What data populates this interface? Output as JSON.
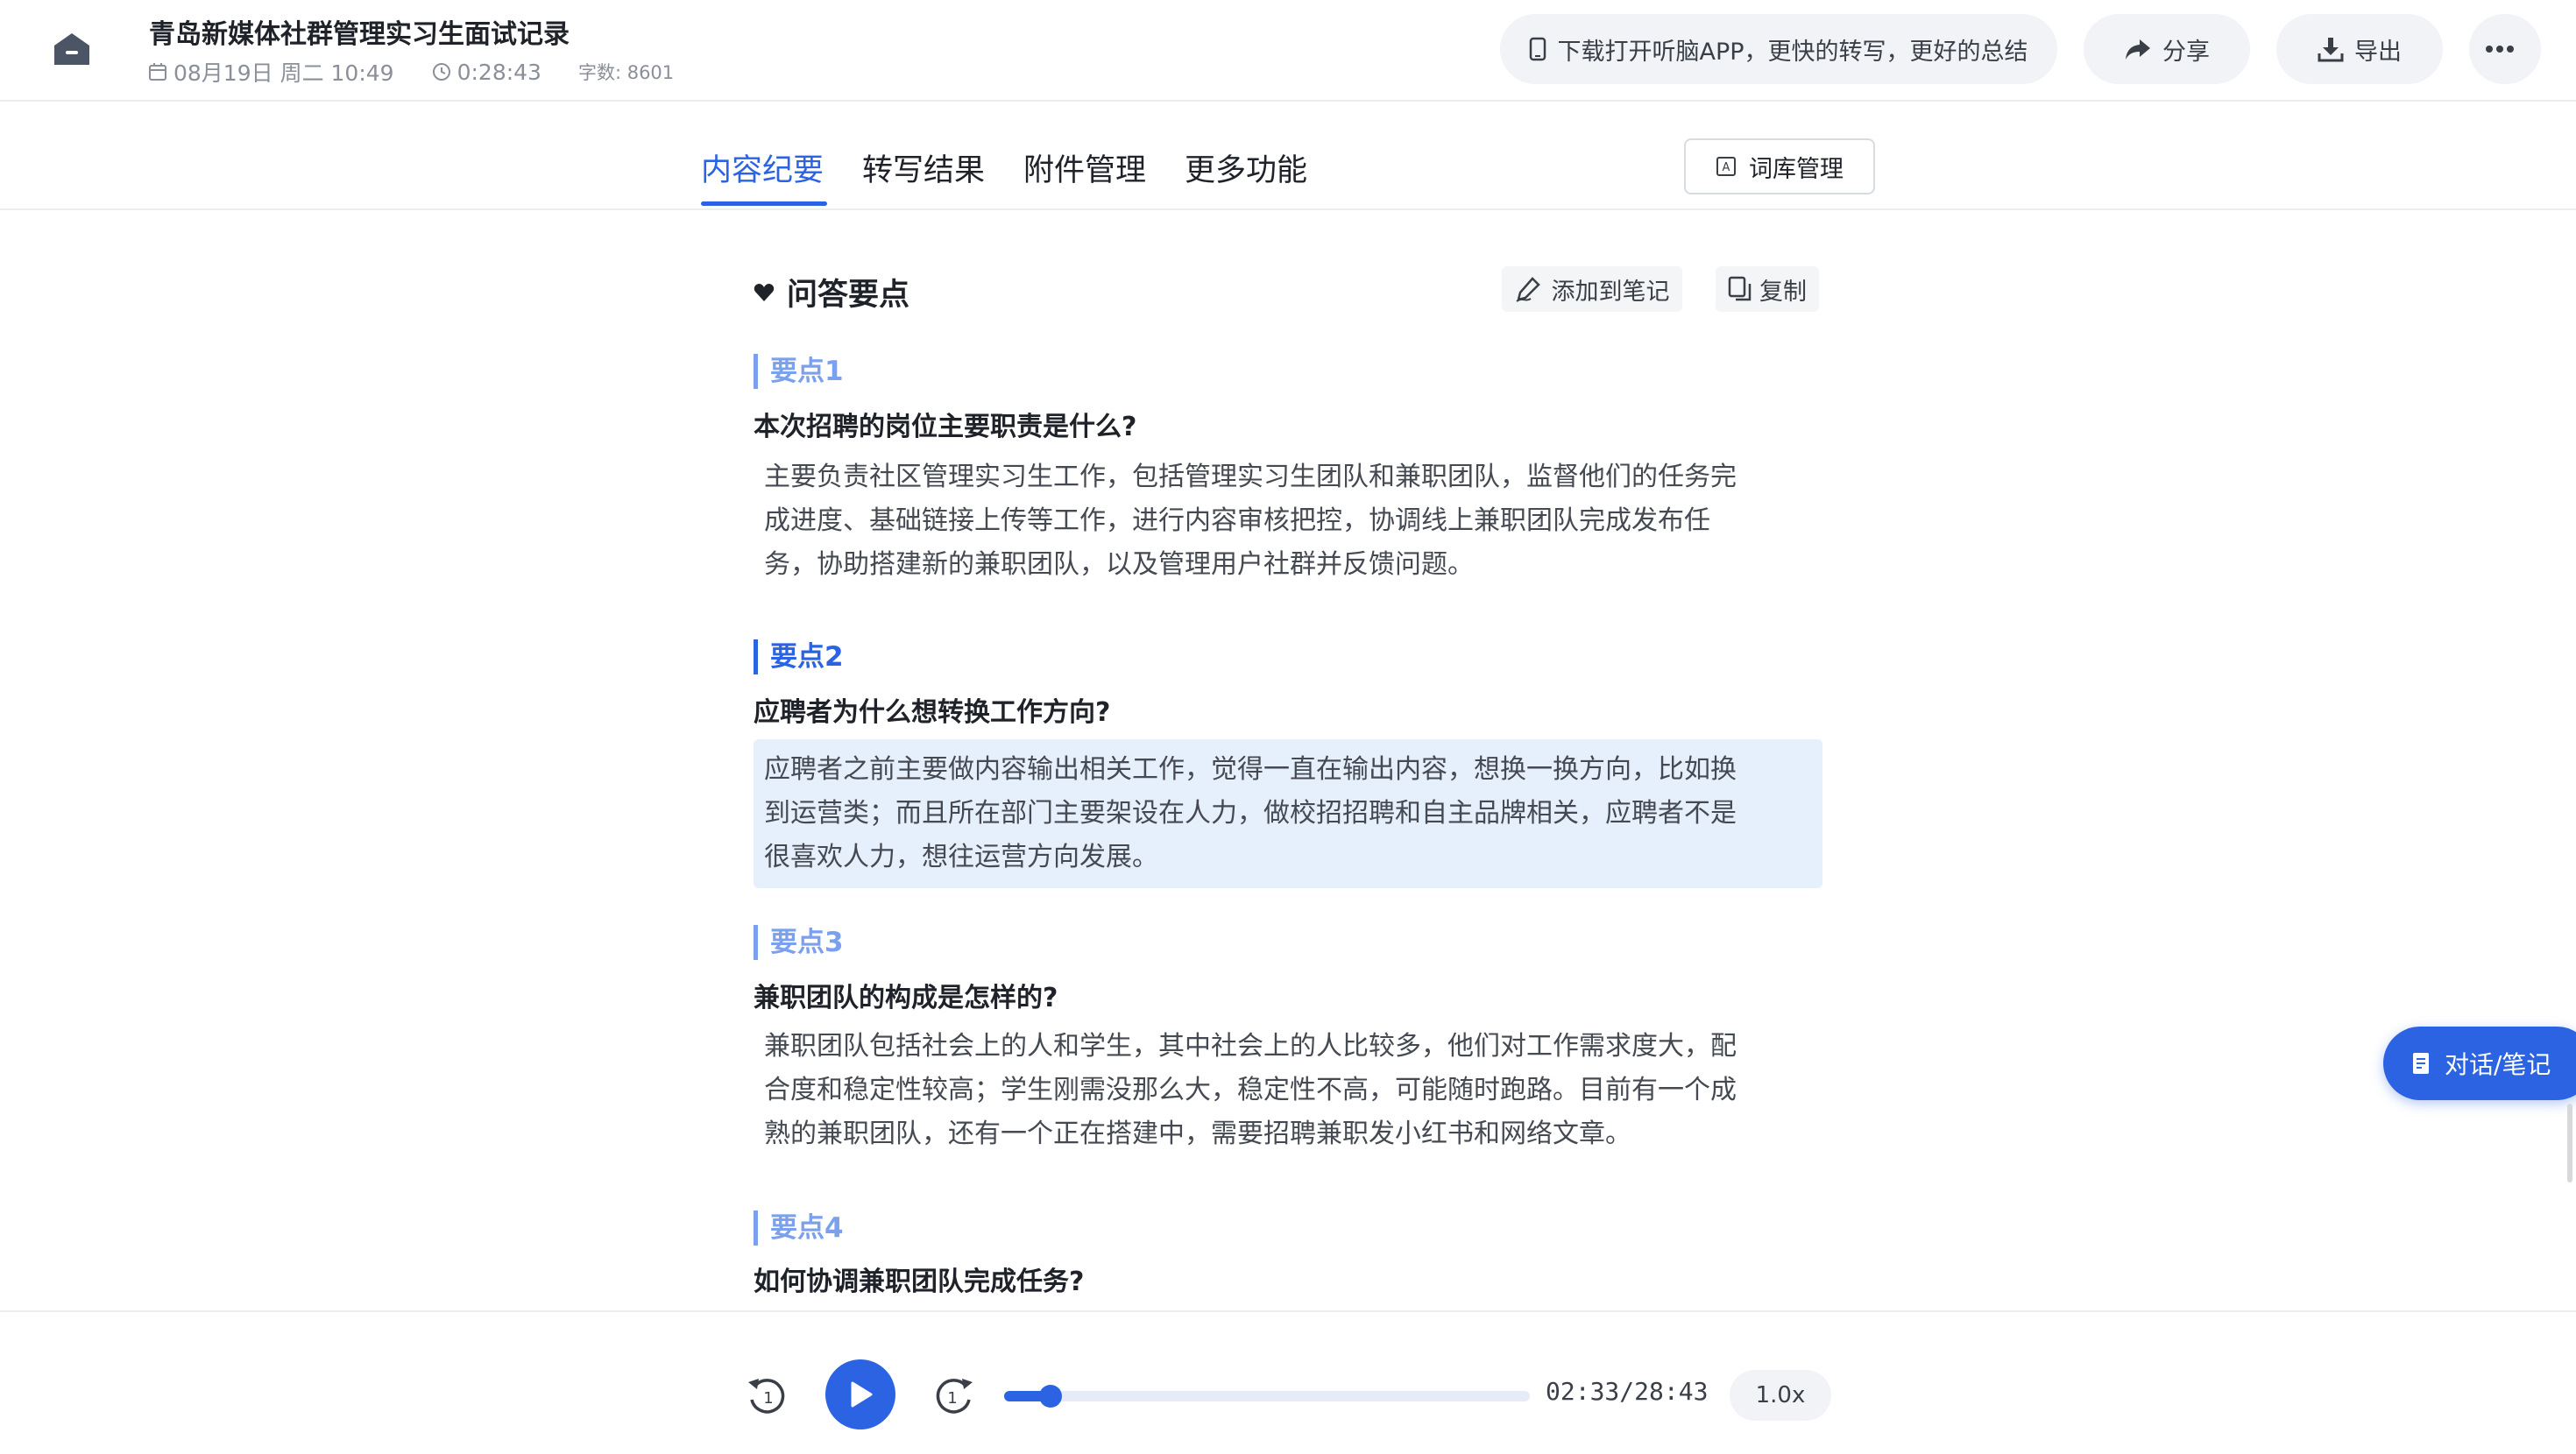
{
  "header": {
    "title": "青岛新媒体社群管理实习生面试记录",
    "date": "08月19日 周二 10:49",
    "duration": "0:28:43",
    "word_count": "字数: 8601",
    "download_app": "下载打开听脑APP，更快的转写，更好的总结",
    "share": "分享",
    "export": "导出"
  },
  "tabs": [
    {
      "label": "内容纪要",
      "active": true
    },
    {
      "label": "转写结果",
      "active": false
    },
    {
      "label": "附件管理",
      "active": false
    },
    {
      "label": "更多功能",
      "active": false
    }
  ],
  "lexicon_button": "词库管理",
  "section": {
    "title": "问答要点",
    "add_to_note": "添加到笔记",
    "copy": "复制"
  },
  "points": [
    {
      "label": "要点1",
      "question": "本次招聘的岗位主要职责是什么?",
      "answer_lines": [
        "主要负责社区管理实习生工作，包括管理实习生团队和兼职团队，监督他们的任务完",
        "成进度、基础链接上传等工作，进行内容审核把控，协调线上兼职团队完成发布任",
        "务，协助搭建新的兼职团队，以及管理用户社群并反馈问题。"
      ]
    },
    {
      "label": "要点2",
      "question": "应聘者为什么想转换工作方向?",
      "answer_lines": [
        "应聘者之前主要做内容输出相关工作，觉得一直在输出内容，想换一换方向，比如换",
        "到运营类；而且所在部门主要架设在人力，做校招招聘和自主品牌相关，应聘者不是",
        "很喜欢人力，想往运营方向发展。"
      ]
    },
    {
      "label": "要点3",
      "question": "兼职团队的构成是怎样的?",
      "answer_lines": [
        "兼职团队包括社会上的人和学生，其中社会上的人比较多，他们对工作需求度大，配",
        "合度和稳定性较高；学生刚需没那么大，稳定性不高，可能随时跑路。目前有一个成",
        "熟的兼职团队，还有一个正在搭建中，需要招聘兼职发小红书和网络文章。"
      ]
    },
    {
      "label": "要点4",
      "question": "如何协调兼职团队完成任务?"
    }
  ],
  "chat_button": "对话/笔记",
  "player": {
    "time": "02:33/28:43",
    "progress": 0.0888,
    "speed": "1.0x"
  },
  "colors": {
    "accent": "#2b63e3",
    "highlight": "#e6effc"
  }
}
